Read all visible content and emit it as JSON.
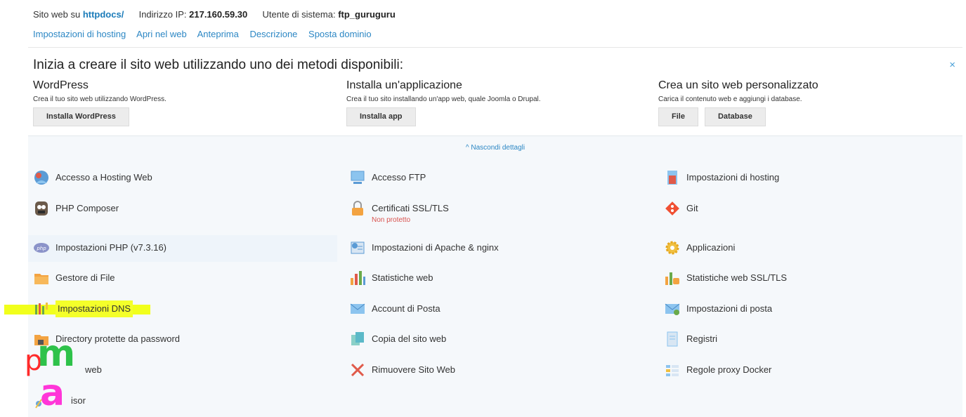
{
  "top": {
    "site_label": "Sito web su",
    "site_path": "httpdocs/",
    "ip_label": "Indirizzo IP:",
    "ip_value": "217.160.59.30",
    "user_label": "Utente di sistema:",
    "user_value": "ftp_guruguru"
  },
  "top_links": [
    "Impostazioni di hosting",
    "Apri nel web",
    "Anteprima",
    "Descrizione",
    "Sposta dominio"
  ],
  "start": {
    "heading": "Inizia a creare il sito web utilizzando uno dei metodi disponibili:",
    "close": "×",
    "methods": [
      {
        "title": "WordPress",
        "desc": "Crea il tuo sito web utilizzando WordPress.",
        "buttons": [
          "Installa WordPress"
        ]
      },
      {
        "title": "Installa un'applicazione",
        "desc": "Crea il tuo sito installando un'app web, quale Joomla o Drupal.",
        "buttons": [
          "Installa app"
        ]
      },
      {
        "title": "Crea un sito web personalizzato",
        "desc": "Carica il contenuto web e aggiungi i database.",
        "buttons": [
          "File",
          "Database"
        ]
      }
    ]
  },
  "toggle": "^ Nascondi dettagli",
  "tools": {
    "col1": [
      {
        "label": "Accesso a Hosting Web",
        "icon": "globe-user-icon"
      },
      {
        "label": "PHP Composer",
        "icon": "composer-icon"
      },
      {
        "label": "Impostazioni PHP (v7.3.16)",
        "icon": "php-icon"
      },
      {
        "label": "Gestore di File",
        "icon": "folder-icon"
      },
      {
        "label": "Impostazioni DNS",
        "icon": "dns-icon"
      },
      {
        "label": "Directory protette da password",
        "icon": "locked-folder-icon"
      },
      {
        "label": "web",
        "icon": "phpmyadmin-icon"
      },
      {
        "label": "isor",
        "icon": "advisor-icon"
      }
    ],
    "col2": [
      {
        "label": "Accesso FTP",
        "icon": "ftp-icon"
      },
      {
        "label": "Certificati SSL/TLS",
        "sub": "Non protetto",
        "icon": "lock-icon"
      },
      {
        "label": "Impostazioni di Apache & nginx",
        "icon": "server-settings-icon"
      },
      {
        "label": "Statistiche web",
        "icon": "bar-chart-icon"
      },
      {
        "label": "Account di Posta",
        "icon": "mail-icon"
      },
      {
        "label": "Copia del sito web",
        "icon": "copy-site-icon"
      },
      {
        "label": "Rimuovere Sito Web",
        "icon": "remove-x-icon"
      }
    ],
    "col3": [
      {
        "label": "Impostazioni di hosting",
        "icon": "hosting-settings-icon"
      },
      {
        "label": "Git",
        "icon": "git-icon"
      },
      {
        "label": "Applicazioni",
        "icon": "gear-apps-icon"
      },
      {
        "label": "Statistiche web SSL/TLS",
        "icon": "ssl-stats-icon"
      },
      {
        "label": "Impostazioni di posta",
        "icon": "mail-settings-icon"
      },
      {
        "label": "Registri",
        "icon": "logs-icon"
      },
      {
        "label": "Regole proxy Docker",
        "icon": "docker-proxy-icon"
      }
    ]
  },
  "pma_logo": "pma",
  "colors": {
    "link": "#2c87c4",
    "panel": "#f5f8fb",
    "highlight": "#f1ff1c",
    "warning": "#d9534f"
  }
}
